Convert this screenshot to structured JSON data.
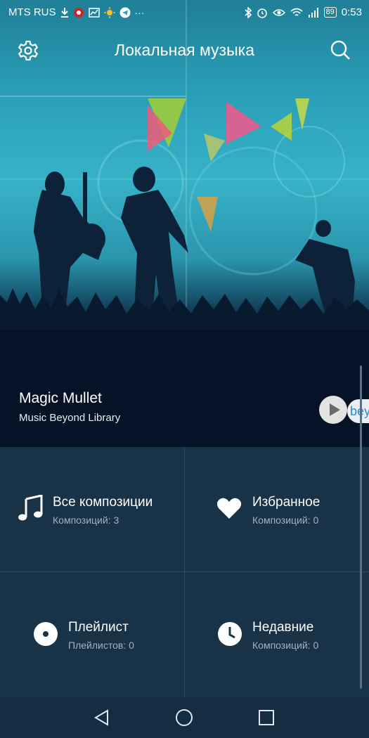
{
  "status_bar": {
    "carrier": "MTS RUS",
    "battery": "89",
    "time": "0:53"
  },
  "header": {
    "title": "Локальная музыка"
  },
  "now_playing": {
    "title": "Magic Mullet",
    "subtitle": "Music Beyond Library",
    "peek_text": "bey"
  },
  "categories": [
    {
      "label": "Все композиции",
      "count": "Композиций: 3",
      "icon": "music-note-icon"
    },
    {
      "label": "Избранное",
      "count": "Композиций: 0",
      "icon": "heart-icon"
    },
    {
      "label": "Плейлист",
      "count": "Плейлистов: 0",
      "icon": "disc-icon"
    },
    {
      "label": "Недавние",
      "count": "Композиций: 0",
      "icon": "clock-icon"
    }
  ],
  "colors": {
    "panel_bg": "#183248",
    "navbar_bg": "#152d42",
    "subtext": "#a5b2bf"
  }
}
